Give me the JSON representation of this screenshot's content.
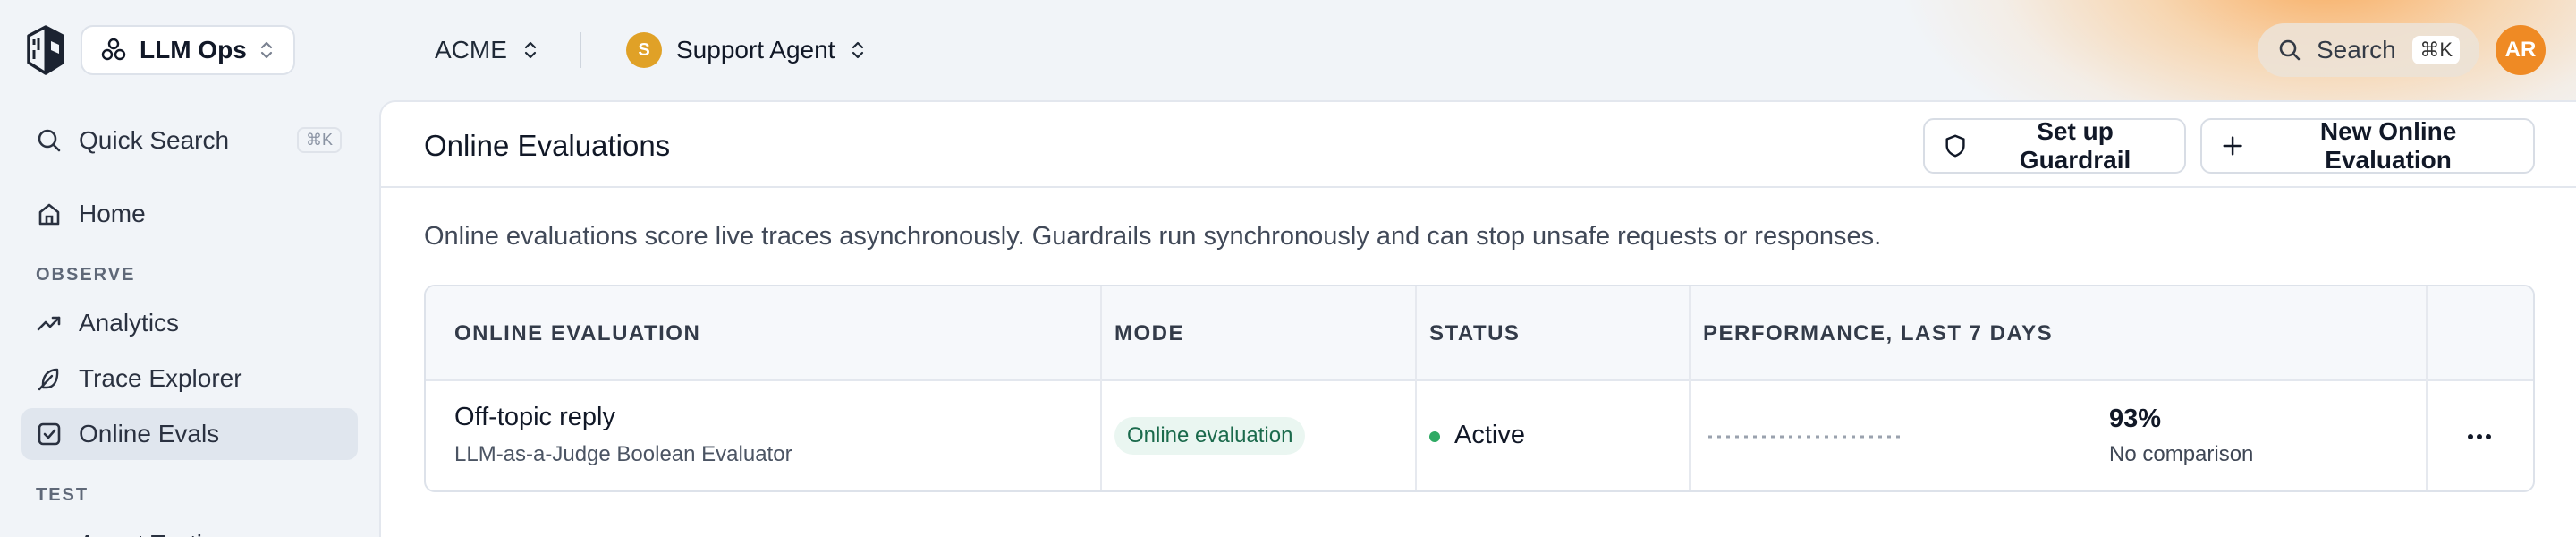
{
  "topbar": {
    "project": {
      "label": "LLM Ops",
      "icon": "hexagon-nodes-icon"
    },
    "org": {
      "label": "ACME"
    },
    "agent": {
      "label": "Support Agent",
      "badge": "S",
      "badge_color": "#e0a127"
    },
    "search": {
      "label": "Search",
      "shortcut": "⌘K"
    },
    "user": {
      "initials": "AR",
      "color": "#ef8a24"
    }
  },
  "sidebar": {
    "quick_search": {
      "label": "Quick Search",
      "shortcut": "⌘K"
    },
    "home": {
      "label": "Home"
    },
    "sections": {
      "observe": "OBSERVE",
      "test": "TEST"
    },
    "items": [
      {
        "label": "Analytics",
        "icon": "trend-up-icon"
      },
      {
        "label": "Trace Explorer",
        "icon": "feather-icon"
      },
      {
        "label": "Online Evals",
        "icon": "checkbox-icon",
        "active": true
      }
    ],
    "cut_item": {
      "label": "Agent Testing"
    }
  },
  "main": {
    "title": "Online Evaluations",
    "buttons": {
      "guardrail": "Set up Guardrail",
      "new_eval": "New Online Evaluation"
    },
    "description": "Online evaluations score live traces asynchronously. Guardrails run synchronously and can stop unsafe requests or responses.",
    "table": {
      "headers": [
        "ONLINE EVALUATION",
        "MODE",
        "STATUS",
        "PERFORMANCE, LAST 7 DAYS",
        ""
      ],
      "rows": [
        {
          "name": "Off-topic reply",
          "evaluator": "LLM-as-a-Judge Boolean Evaluator",
          "mode": "Online evaluation",
          "status": "Active",
          "status_color": "#2faa64",
          "performance": "93%",
          "comparison": "No comparison"
        }
      ]
    }
  }
}
